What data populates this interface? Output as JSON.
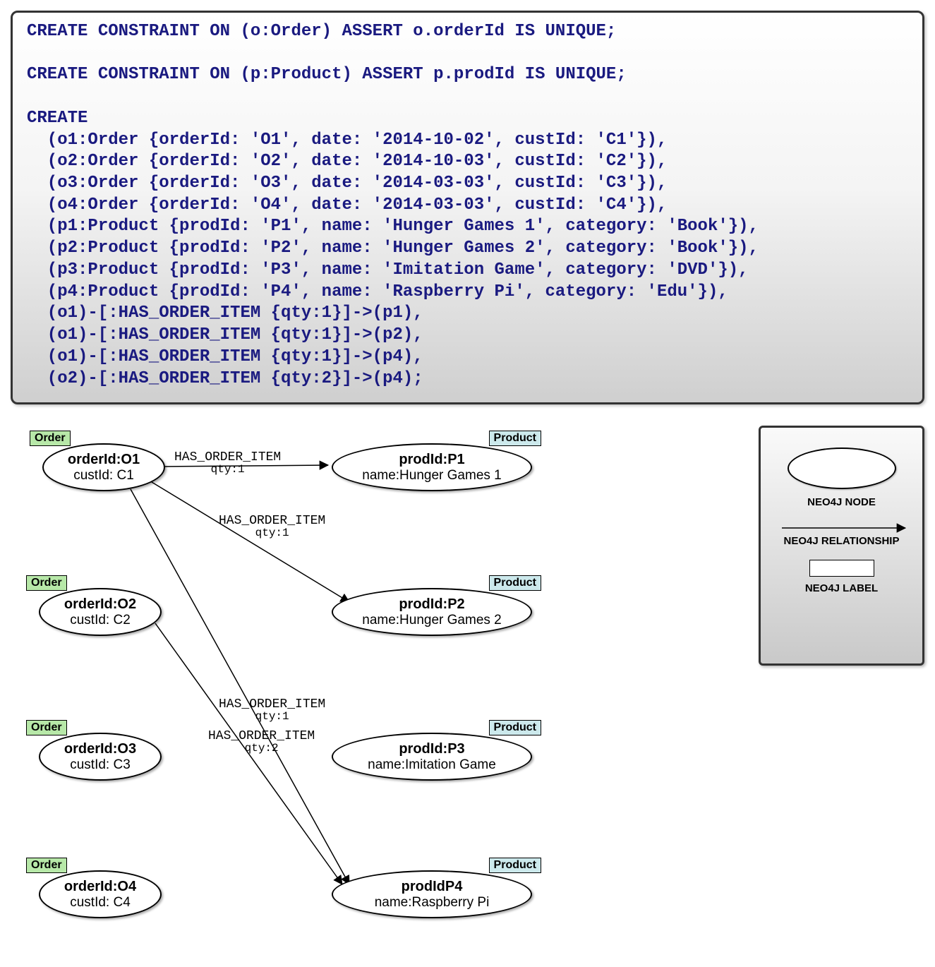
{
  "code": {
    "line1": "CREATE CONSTRAINT ON (o:Order) ASSERT o.orderId IS UNIQUE;",
    "line2": "",
    "line3": "CREATE CONSTRAINT ON (p:Product) ASSERT p.prodId IS UNIQUE;",
    "line4": "",
    "line5": "CREATE",
    "line6": "  (o1:Order {orderId: 'O1', date: '2014-10-02', custId: 'C1'}),",
    "line7": "  (o2:Order {orderId: 'O2', date: '2014-10-03', custId: 'C2'}),",
    "line8": "  (o3:Order {orderId: 'O3', date: '2014-03-03', custId: 'C3'}),",
    "line9": "  (o4:Order {orderId: 'O4', date: '2014-03-03', custId: 'C4'}),",
    "line10": "  (p1:Product {prodId: 'P1', name: 'Hunger Games 1', category: 'Book'}),",
    "line11": "  (p2:Product {prodId: 'P2', name: 'Hunger Games 2', category: 'Book'}),",
    "line12": "  (p3:Product {prodId: 'P3', name: 'Imitation Game', category: 'DVD'}),",
    "line13": "  (p4:Product {prodId: 'P4', name: 'Raspberry Pi', category: 'Edu'}),",
    "line14": "  (o1)-[:HAS_ORDER_ITEM {qty:1}]->(p1),",
    "line15": "  (o1)-[:HAS_ORDER_ITEM {qty:1}]->(p2),",
    "line16": "  (o1)-[:HAS_ORDER_ITEM {qty:1}]->(p4),",
    "line17": "  (o2)-[:HAS_ORDER_ITEM {qty:2}]->(p4);"
  },
  "orders": {
    "o1": {
      "label": "Order",
      "id_line": "orderId:O1",
      "cust_line": "custId: C1"
    },
    "o2": {
      "label": "Order",
      "id_line": "orderId:O2",
      "cust_line": "custId: C2"
    },
    "o3": {
      "label": "Order",
      "id_line": "orderId:O3",
      "cust_line": "custId: C3"
    },
    "o4": {
      "label": "Order",
      "id_line": "orderId:O4",
      "cust_line": "custId: C4"
    }
  },
  "products": {
    "p1": {
      "label": "Product",
      "id_line": "prodId:P1",
      "name_line": "name:Hunger Games 1"
    },
    "p2": {
      "label": "Product",
      "id_line": "prodId:P2",
      "name_line": "name:Hunger Games 2"
    },
    "p3": {
      "label": "Product",
      "id_line": "prodId:P3",
      "name_line": "name:Imitation Game"
    },
    "p4": {
      "label": "Product",
      "id_line": "prodIdP4",
      "name_line": "name:Raspberry Pi"
    }
  },
  "rels": {
    "r1": {
      "name": "HAS_ORDER_ITEM",
      "qty": "qty:1"
    },
    "r2": {
      "name": "HAS_ORDER_ITEM",
      "qty": "qty:1"
    },
    "r3": {
      "name": "HAS_ORDER_ITEM",
      "qty": "qty:1"
    },
    "r4": {
      "name": "HAS_ORDER_ITEM",
      "qty": "qty:2"
    }
  },
  "legend": {
    "node": "NEO4J NODE",
    "relationship": "NEO4J RELATIONSHIP",
    "label": "NEO4J LABEL"
  },
  "chart_data": {
    "type": "graph",
    "title": "",
    "node_types": [
      {
        "name": "Order",
        "color": "#b7e8a8"
      },
      {
        "name": "Product",
        "color": "#cce9ec"
      }
    ],
    "nodes": [
      {
        "id": "O1",
        "type": "Order",
        "orderId": "O1",
        "custId": "C1",
        "date": "2014-10-02"
      },
      {
        "id": "O2",
        "type": "Order",
        "orderId": "O2",
        "custId": "C2",
        "date": "2014-10-03"
      },
      {
        "id": "O3",
        "type": "Order",
        "orderId": "O3",
        "custId": "C3",
        "date": "2014-03-03"
      },
      {
        "id": "O4",
        "type": "Order",
        "orderId": "O4",
        "custId": "C4",
        "date": "2014-03-03"
      },
      {
        "id": "P1",
        "type": "Product",
        "prodId": "P1",
        "name": "Hunger Games 1",
        "category": "Book"
      },
      {
        "id": "P2",
        "type": "Product",
        "prodId": "P2",
        "name": "Hunger Games 2",
        "category": "Book"
      },
      {
        "id": "P3",
        "type": "Product",
        "prodId": "P3",
        "name": "Imitation Game",
        "category": "DVD"
      },
      {
        "id": "P4",
        "type": "Product",
        "prodId": "P4",
        "name": "Raspberry Pi",
        "category": "Edu"
      }
    ],
    "edges": [
      {
        "from": "O1",
        "to": "P1",
        "rel": "HAS_ORDER_ITEM",
        "qty": 1
      },
      {
        "from": "O1",
        "to": "P2",
        "rel": "HAS_ORDER_ITEM",
        "qty": 1
      },
      {
        "from": "O1",
        "to": "P4",
        "rel": "HAS_ORDER_ITEM",
        "qty": 1
      },
      {
        "from": "O2",
        "to": "P4",
        "rel": "HAS_ORDER_ITEM",
        "qty": 2
      }
    ],
    "legend": [
      "NEO4J NODE",
      "NEO4J RELATIONSHIP",
      "NEO4J LABEL"
    ]
  }
}
